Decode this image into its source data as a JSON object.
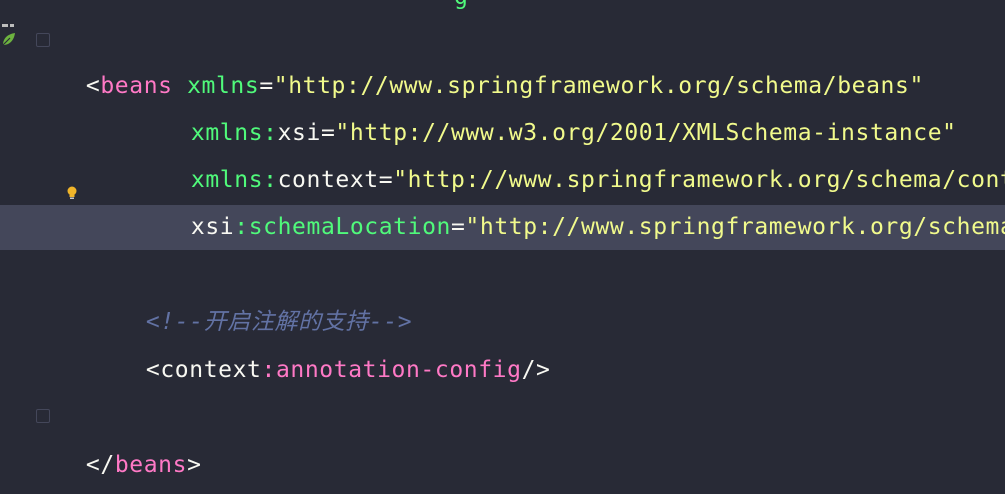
{
  "editor": {
    "top_partial": "g",
    "lines": [
      {
        "indent": "",
        "open": "<",
        "tag": "beans",
        "sp": " ",
        "attr": "xmlns",
        "eq": "=",
        "val": "\"http://www.springframework.org/schema/beans\""
      },
      {
        "indent": "     ",
        "attr_ns": "xmlns",
        "colon": ":",
        "attr_local": "xsi",
        "eq": "=",
        "val": "\"http://www.w3.org/2001/XMLSchema-instance\""
      },
      {
        "indent": "     ",
        "attr_ns": "xmlns",
        "colon": ":",
        "attr_local": "context",
        "eq": "=",
        "val": "\"http://www.springframework.org/schema/cont"
      },
      {
        "indent": "     ",
        "attr_ns": "xsi",
        "colon": ":",
        "attr_local": "schemaLocation",
        "eq": "=",
        "val": "\"http://www.springframework.org/schema"
      },
      {
        "comment": "<!--开启注解的支持-->"
      },
      {
        "open": "<",
        "ns": "context",
        "colon": ":",
        "tag": "annotation-config",
        "close": "/>"
      },
      {
        "open": "</",
        "tag": "beans",
        "close": ">"
      }
    ]
  },
  "colors": {
    "background": "#282a36",
    "current_line": "#44475a",
    "tag": "#ff79c6",
    "attribute": "#50fa7b",
    "string": "#f1fa8c",
    "comment": "#6272a4"
  },
  "icons": [
    "spring-leaf-icon",
    "fold-marker-icon",
    "lightbulb-icon"
  ]
}
